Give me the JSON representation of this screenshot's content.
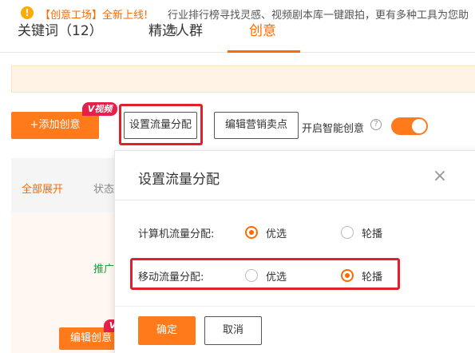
{
  "tabs": [
    {
      "label": "关键词（12）"
    },
    {
      "label": "精选人群"
    },
    {
      "label": "创意"
    }
  ],
  "active_tab": "创意",
  "notice": {
    "icon": "warning-icon",
    "highlight": "【创意工场】全新上线!",
    "text": "行业排行榜寻找灵感、视频剧本库一键跟拍，更有多种工具为您助力"
  },
  "toolbar": {
    "add_label": "+添加创意",
    "video_badge": "V视频",
    "traffic_label": "设置流量分配",
    "selling_label": "编辑营销卖点",
    "smart_label": "开启智能创意",
    "smart_on": true
  },
  "table": {
    "expand_all": "全部展开",
    "status_col": "状态",
    "promo_text": "推广",
    "edit_creative": "编辑创意",
    "v_badge": "V"
  },
  "dialog": {
    "title": "设置流量分配",
    "rows": [
      {
        "label": "计算机流量分配:",
        "options": [
          "优选",
          "轮播"
        ],
        "selected": "优选"
      },
      {
        "label": "移动流量分配:",
        "options": [
          "优选",
          "轮播"
        ],
        "selected": "轮播"
      }
    ],
    "confirm": "确定",
    "cancel": "取消"
  },
  "colors": {
    "accent": "#ff6a00",
    "highlight_box": "#e0202a"
  }
}
